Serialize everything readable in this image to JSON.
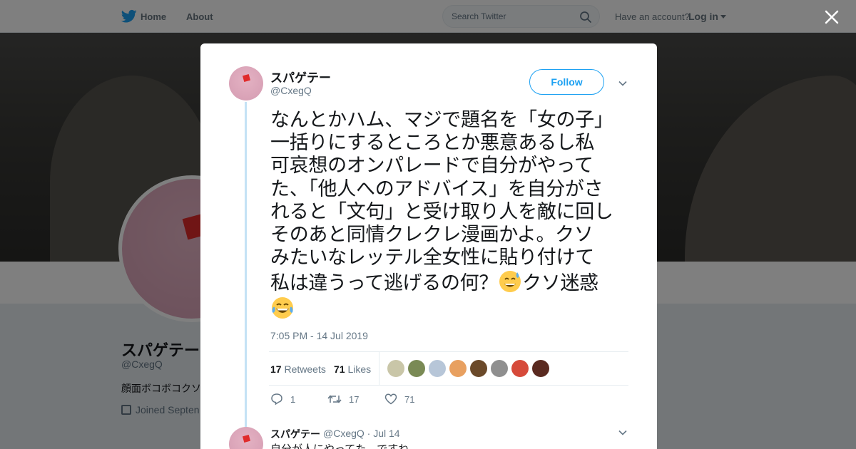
{
  "nav": {
    "home": "Home",
    "about": "About",
    "search_placeholder": "Search Twitter",
    "have_account": "Have an account?",
    "login": "Log in"
  },
  "profile_bg": {
    "name": "スパゲテー",
    "handle": "@CxegQ",
    "bio": "顔面ボコボコクソ",
    "joined": "Joined Septen"
  },
  "tweet": {
    "name": "スパゲテー",
    "handle": "@CxegQ",
    "follow_label": "Follow",
    "text_lines": [
      "なんとかハム、マジで題名を「女の子」",
      "一括りにするところとか悪意あるし私",
      "可哀想のオンパレードで自分がやって",
      "た、「他人へのアドバイス」を自分がさ",
      "れると「文句」と受け取り人を敵に回し",
      "そのあと同情クレクレ漫画かよ。クソ",
      "みたいなレッテル全女性に貼り付けて",
      "私は違うって逃げるの何？"
    ],
    "text_after_emoji": "クソ迷惑",
    "emoji_1": "grinning-sweat-emoji",
    "emoji_2": "tears-of-joy-emoji",
    "timestamp": "7:05 PM - 14 Jul 2019",
    "retweets_count": "17",
    "retweets_label": "Retweets",
    "likes_count": "71",
    "likes_label": "Likes",
    "liker_colors": [
      "#c9c6a8",
      "#7a8a55",
      "#b7c6d8",
      "#e8a060",
      "#6b4a2a",
      "#8f8f8f",
      "#d64a3a",
      "#5a2a20"
    ],
    "actions": {
      "replies": "1",
      "retweets": "17",
      "likes": "71"
    }
  },
  "reply": {
    "name": "スパゲテー",
    "handle_date": "@CxegQ · Jul 14",
    "text": "自分が人にやってた、ですね"
  },
  "colors": {
    "accent": "#1da1f2",
    "overlay": "rgba(0,0,0,0.5)",
    "thread_line": "#c4e2f5"
  }
}
